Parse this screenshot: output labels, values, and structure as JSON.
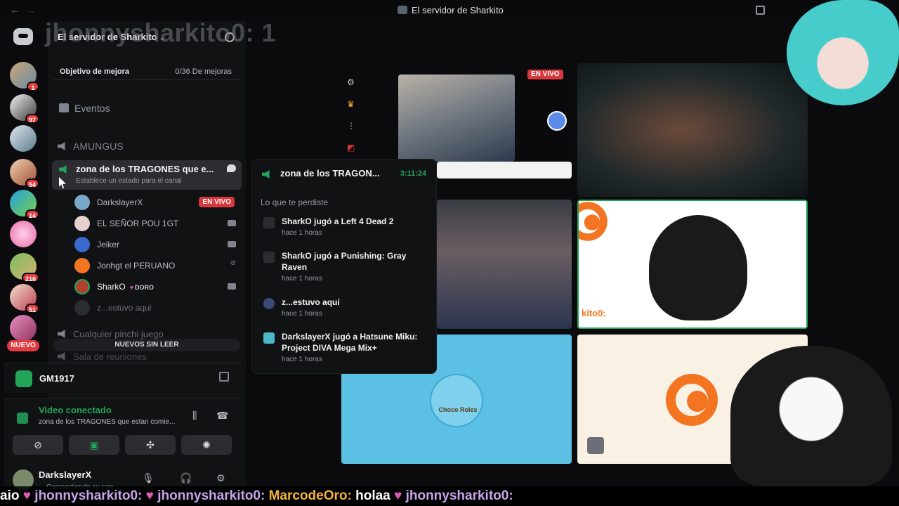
{
  "window": {
    "title": "El servidor de Sharkito"
  },
  "overlay": {
    "stream_name": "jhonnysharkito0: 1"
  },
  "rail": {
    "servers": [
      {
        "badge": "1"
      },
      {
        "badge": "97"
      },
      {
        "badge": ""
      },
      {
        "badge": "54"
      },
      {
        "badge": "14"
      },
      {
        "badge": ""
      },
      {
        "badge": "216"
      },
      {
        "badge": "51"
      }
    ],
    "new_label": "NUEVO"
  },
  "sidebar": {
    "server_name": "El servidor de Sharkito",
    "boost": {
      "label": "Objetivo de mejora",
      "progress": "0/36 De mejoras"
    },
    "events": "Eventos",
    "channels": {
      "amungus": "AMUNGUS",
      "active_name": "zona de los TRAGONES que e...",
      "active_sub": "Establece un estado para el canal",
      "users": [
        {
          "name": "DarkslayerX",
          "live": "EN VIVO"
        },
        {
          "name": "EL SEÑOR POU 1GT"
        },
        {
          "name": "Jeiker"
        },
        {
          "name": "Jonhgt el PERUANO"
        },
        {
          "name": "SharkO",
          "tag": "DORO"
        },
        {
          "name": "z...estuvo aqui"
        }
      ],
      "next": "Cualquier pinchi juego",
      "next2": "Sala de reuniones"
    },
    "unread_label": "NUEVOS SIN LEER"
  },
  "panel": {
    "gm_name": "GM1917",
    "voice_status": "Video conectado",
    "voice_channel": "zona de los TRAGONES que estan comie...",
    "user_name": "DarkslayerX",
    "user_status": "Compartiendo su pan..."
  },
  "popup": {
    "channel": "zona de los TRAGON...",
    "time": "3:11:24",
    "missed_label": "Lo que te perdiste",
    "items": [
      {
        "text": "SharkO jugó a Left 4 Dead 2",
        "ago": "hace 1 horas"
      },
      {
        "text": "SharkO jugó a Punishing: Gray Raven",
        "ago": "hace 1 horas"
      },
      {
        "text": "z...estuvo aquí",
        "ago": "hace 1 horas"
      },
      {
        "text": "DarkslayerX jugó a Hatsune Miku: Project DIVA Mega Mix+",
        "ago": "hace 1 horas"
      }
    ]
  },
  "stage": {
    "live_badge": "EN VIVO",
    "tile_label": "kito0:",
    "avatar_text": "Choco Roles"
  },
  "ticker": {
    "segments": [
      {
        "user": "aio",
        "msg": ""
      },
      {
        "user": "jhonnysharkito0:",
        "msg": ""
      },
      {
        "user": "jhonnysharkito0:",
        "msg": ""
      },
      {
        "user": "MarcodeOro:",
        "msg": "holaa"
      },
      {
        "user": "jhonnysharkito0:",
        "msg": ""
      }
    ]
  },
  "colors": {
    "green": "#23a559",
    "live_red": "#da373c",
    "crunchyroll": "#f47521"
  }
}
